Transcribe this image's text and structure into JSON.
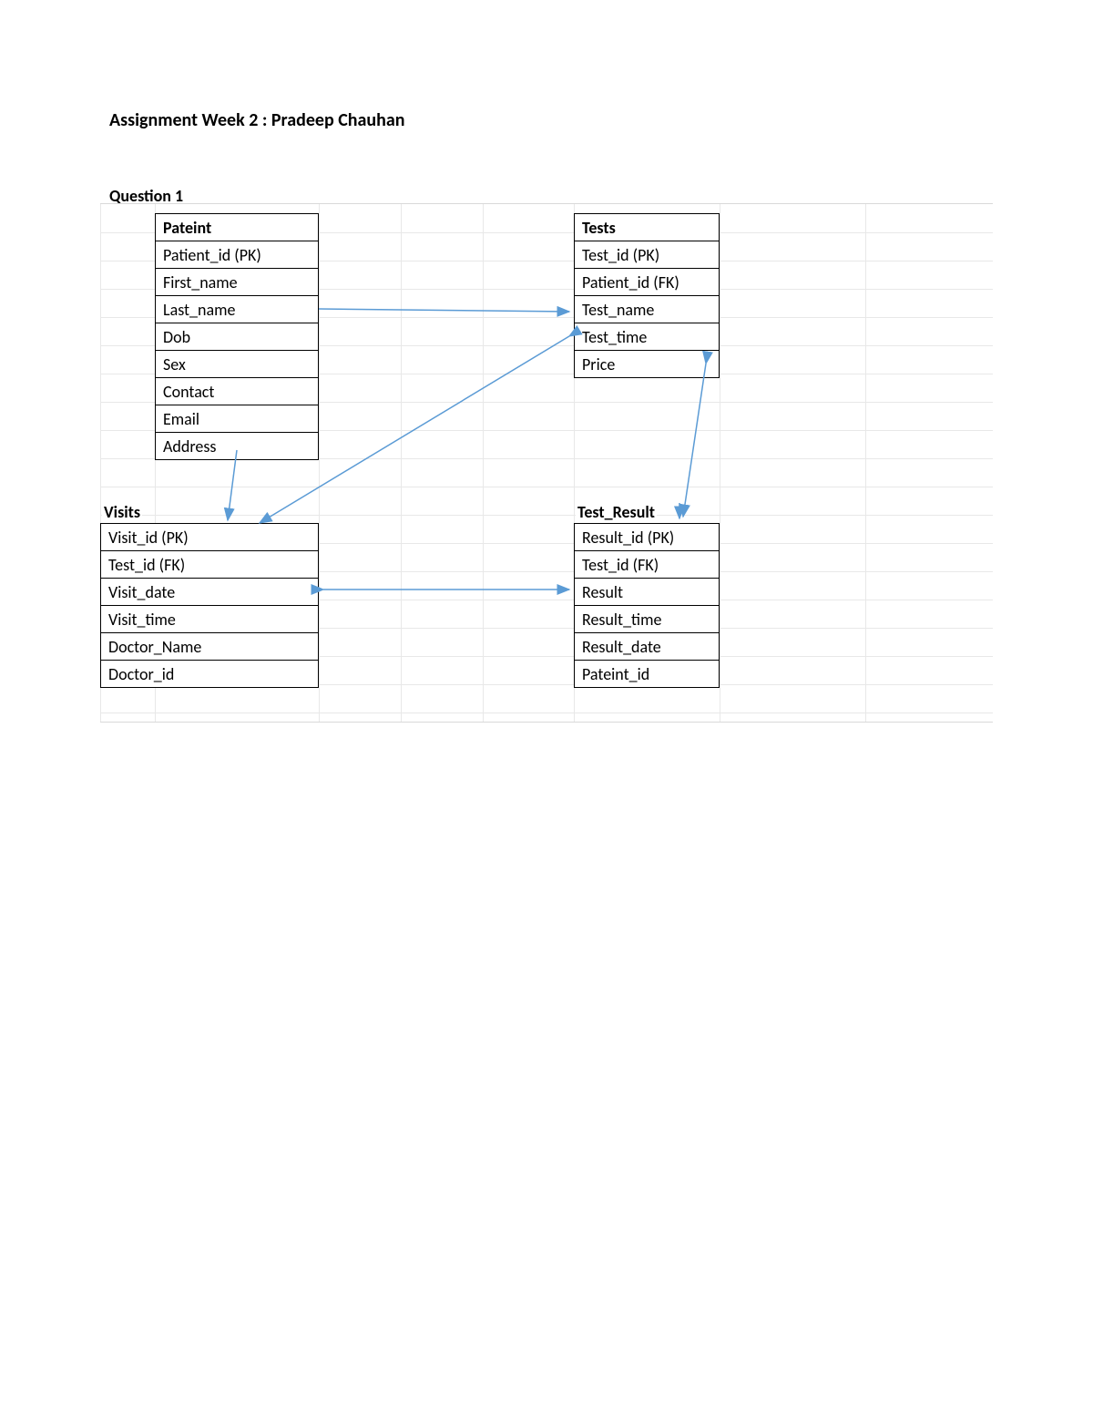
{
  "title": "Assignment Week 2 : Pradeep Chauhan",
  "question_label": "Question 1",
  "entities": {
    "patient": {
      "header": "Pateint",
      "rows": [
        "Patient_id (PK)",
        "First_name",
        "Last_name",
        "Dob",
        "Sex",
        "Contact",
        "Email",
        "Address"
      ]
    },
    "tests": {
      "header": "Tests",
      "rows": [
        "Test_id (PK)",
        "Patient_id (FK)",
        "Test_name",
        "Test_time",
        "Price"
      ]
    },
    "visits": {
      "header": "Visits",
      "rows": [
        "Visit_id (PK)",
        "Test_id (FK)",
        "Visit_date",
        "Visit_time",
        "Doctor_Name",
        "Doctor_id"
      ]
    },
    "test_result": {
      "header": "Test_Result",
      "rows": [
        "Result_id (PK)",
        "Test_id (FK)",
        "Result",
        "Result_time",
        "Result_date",
        "Pateint_id"
      ]
    }
  },
  "arrows": {
    "color": "#5B9BD5"
  }
}
